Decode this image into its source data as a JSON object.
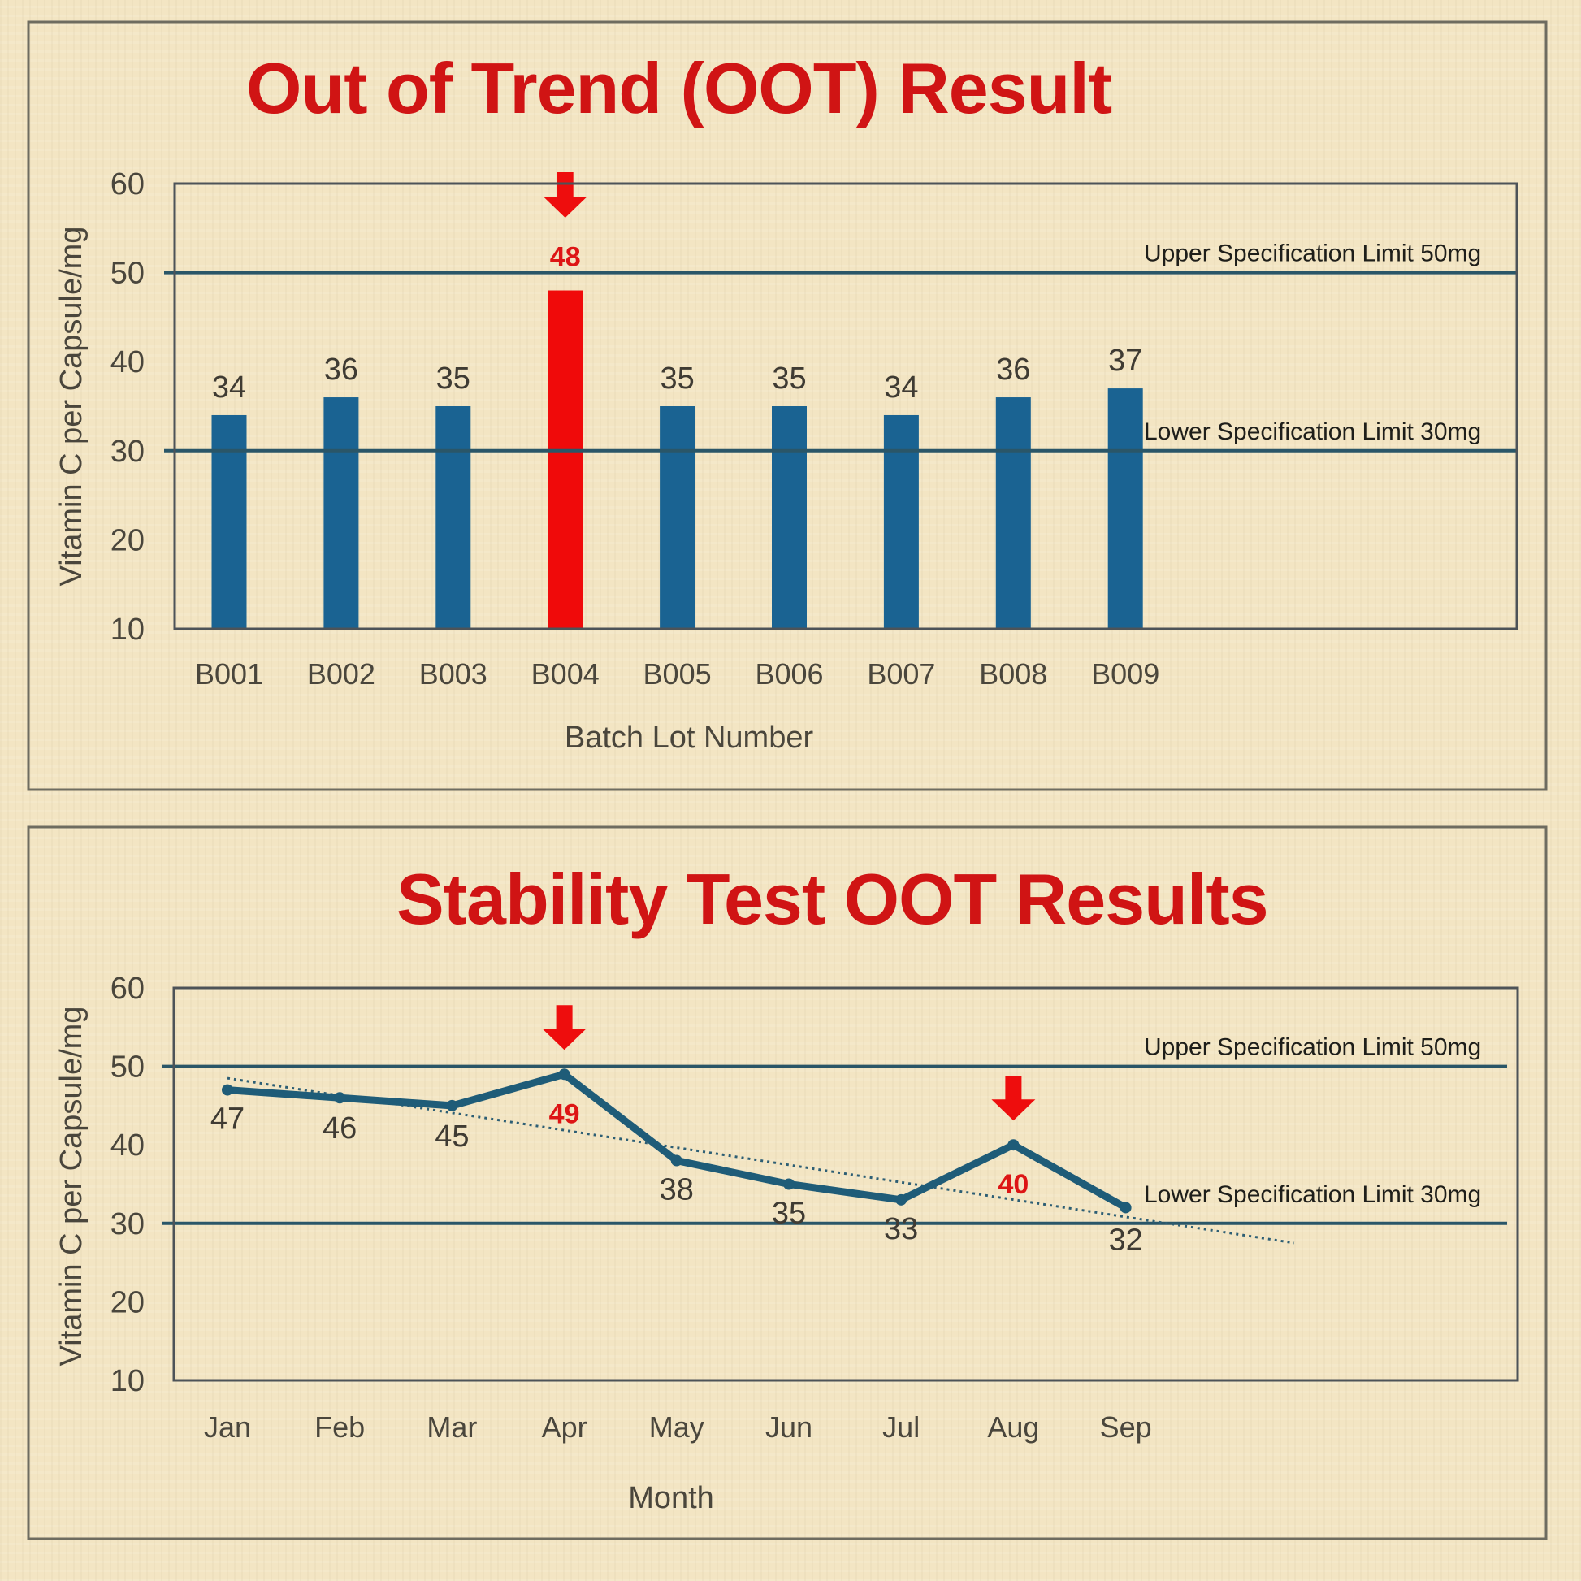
{
  "chart_data": [
    {
      "type": "bar",
      "title": "Out of Trend (OOT) Result",
      "xlabel": "Batch Lot Number",
      "ylabel": "Vitamin C per Capsule/mg",
      "ylim": [
        10,
        60
      ],
      "yticks": [
        60,
        50,
        40,
        30,
        20,
        10
      ],
      "grid": false,
      "categories": [
        "B001",
        "B002",
        "B003",
        "B004",
        "B005",
        "B006",
        "B007",
        "B008",
        "B009"
      ],
      "values": [
        34,
        36,
        35,
        48,
        35,
        35,
        34,
        36,
        37
      ],
      "highlighted": [
        "B004"
      ],
      "reference_lines": [
        {
          "label": "Upper Specification Limit 50mg",
          "value": 50
        },
        {
          "label": "Lower Specification Limit 30mg",
          "value": 30
        }
      ],
      "colors": {
        "bar": "#1a6392",
        "highlight": "#f00a0a",
        "reference": "#2a5668"
      }
    },
    {
      "type": "line",
      "title": "Stability Test OOT Results",
      "xlabel": "Month",
      "ylabel": "Vitamin C per Capsule/mg",
      "ylim": [
        10,
        60
      ],
      "yticks": [
        60,
        50,
        40,
        30,
        20,
        10
      ],
      "grid": false,
      "categories": [
        "Jan",
        "Feb",
        "Mar",
        "Apr",
        "May",
        "Jun",
        "Jul",
        "Aug",
        "Sep"
      ],
      "series": [
        {
          "name": "Vitamin C",
          "values": [
            47,
            46,
            45,
            49,
            38,
            35,
            33,
            40,
            32
          ]
        }
      ],
      "trendline": {
        "style": "dotted",
        "start_value": 48.5,
        "end_value": 27.5,
        "extends_past_last_category": 1.5
      },
      "highlighted": [
        "Apr",
        "Aug"
      ],
      "reference_lines": [
        {
          "label": "Upper Specification Limit 50mg",
          "value": 50
        },
        {
          "label": "Lower Specification Limit 30mg",
          "value": 30
        }
      ],
      "colors": {
        "line": "#1f5c78",
        "highlight": "#dd1515",
        "reference": "#2a5668"
      }
    }
  ]
}
